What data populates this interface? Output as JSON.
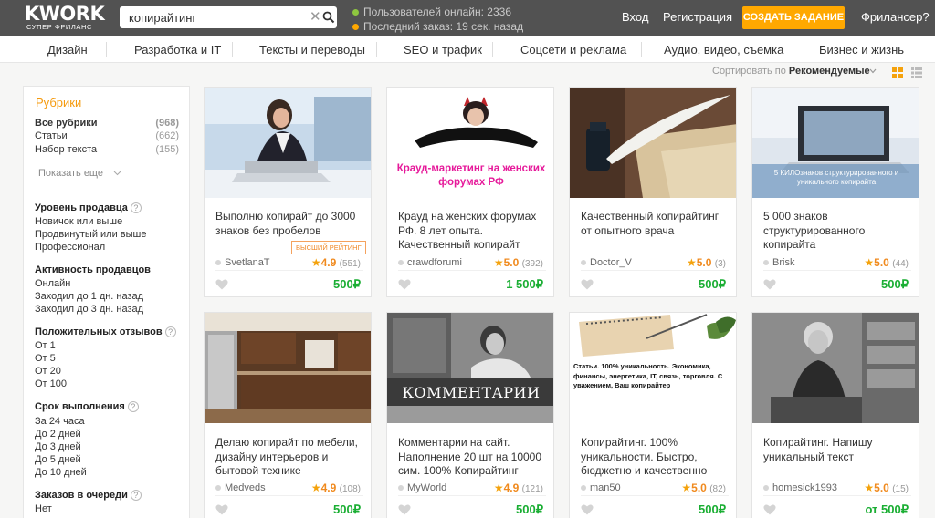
{
  "header": {
    "logo_text": "KWORK",
    "logo_sub": "СУПЕР ФРИЛАНС",
    "search_value": "копирайтинг",
    "online_text": "Пользователей онлайн: 2336",
    "last_order_text": "Последний заказ: 19 сек. назад",
    "login": "Вход",
    "register": "Регистрация",
    "create_task": "СОЗДАТЬ ЗАДАНИЕ",
    "freelancer": "Фрилансер?",
    "colors": {
      "bg": "#525252",
      "accent": "#ffa800",
      "online_dot": "#8ec63f",
      "order_dot": "#ffa800"
    }
  },
  "categories": [
    "Дизайн",
    "Разработка и IT",
    "Тексты и переводы",
    "SEO и трафик",
    "Соцсети и реклама",
    "Аудио, видео, съемка",
    "Бизнес и жизнь"
  ],
  "sort": {
    "label": "Сортировать по",
    "value": "Рекомендуемые"
  },
  "sidebar": {
    "title": "Рубрики",
    "rubrics": [
      {
        "label": "Все рубрики",
        "count": "(968)"
      },
      {
        "label": "Статьи",
        "count": "(662)"
      },
      {
        "label": "Набор текста",
        "count": "(155)"
      }
    ],
    "show_more": "Показать еще",
    "seller_level": {
      "title": "Уровень продавца",
      "items": [
        "Новичок или выше",
        "Продвинутый или выше",
        "Профессионал"
      ]
    },
    "activity": {
      "title": "Активность продавцов",
      "items": [
        "Онлайн",
        "Заходил до 1 дн. назад",
        "Заходил до 3 дн. назад"
      ]
    },
    "reviews": {
      "title": "Положительных отзывов",
      "items": [
        "От 1",
        "От 5",
        "От 20",
        "От 100"
      ]
    },
    "deadline": {
      "title": "Срок выполнения",
      "items": [
        "За 24 часа",
        "До 2 дней",
        "До 3 дней",
        "До 5 дней",
        "До 10 дней"
      ]
    },
    "queue": {
      "title": "Заказов в очереди",
      "items": [
        "Нет"
      ]
    }
  },
  "cards": [
    {
      "title": "Выполню копирайт до 3000 знаков без пробелов",
      "badge": "ВЫСШИЙ РЕЙТИНГ",
      "seller": "SvetlanaT",
      "rating": "4.9",
      "reviews": "(551)",
      "price": "500₽",
      "image": "woman-laptop-photo"
    },
    {
      "title": "Крауд на женских форумах РФ. 8 лет опыта. Качественный копирайт",
      "seller": "crawdforumi",
      "rating": "5.0",
      "reviews": "(392)",
      "price": "1 500₽",
      "image_text": "Крауд-маркетинг на женских форумах РФ",
      "image": "woman-devil-horns-photo"
    },
    {
      "title": "Качественный копирайтинг от опытного врача",
      "seller": "Doctor_V",
      "rating": "5.0",
      "reviews": "(3)",
      "price": "500₽",
      "image": "quill-ink-paper-photo"
    },
    {
      "title": "5 000 знаков структурированного копирайта",
      "seller": "Brisk",
      "rating": "5.0",
      "reviews": "(44)",
      "price": "500₽",
      "image_text": "5 КИЛОзнаков структурированного и уникального копирайта",
      "image": "laptop-desk-photo"
    },
    {
      "title": "Делаю копирайт по мебели, дизайну интерьеров и бытовой технике",
      "seller": "Medveds",
      "rating": "4.9",
      "reviews": "(108)",
      "price": "500₽",
      "image": "kitchen-interior-photo"
    },
    {
      "title": "Комментарии на сайт. Наполнение 20 шт на 10000 сим. 100% Копирайтинг",
      "seller": "MyWorld",
      "rating": "4.9",
      "reviews": "(121)",
      "price": "500₽",
      "image_text": "КОММЕНТАРИИ",
      "image": "man-writing-photo"
    },
    {
      "title": "Копирайтинг. 100% уникальности. Быстро, бюджетно и качественно",
      "seller": "man50",
      "rating": "5.0",
      "reviews": "(82)",
      "price": "500₽",
      "image_text": "Статьи. 100% уникальность. Экономика, финансы, энергетика, IT, связь, торговля. С уважением, Ваш копирайтер",
      "image": "notebook-pen-photo"
    },
    {
      "title": "Копирайтинг. Напишу уникальный текст",
      "seller": "homesick1993",
      "rating": "5.0",
      "reviews": "(15)",
      "price": "от 500₽",
      "image": "vintage-secretary-photo"
    }
  ]
}
